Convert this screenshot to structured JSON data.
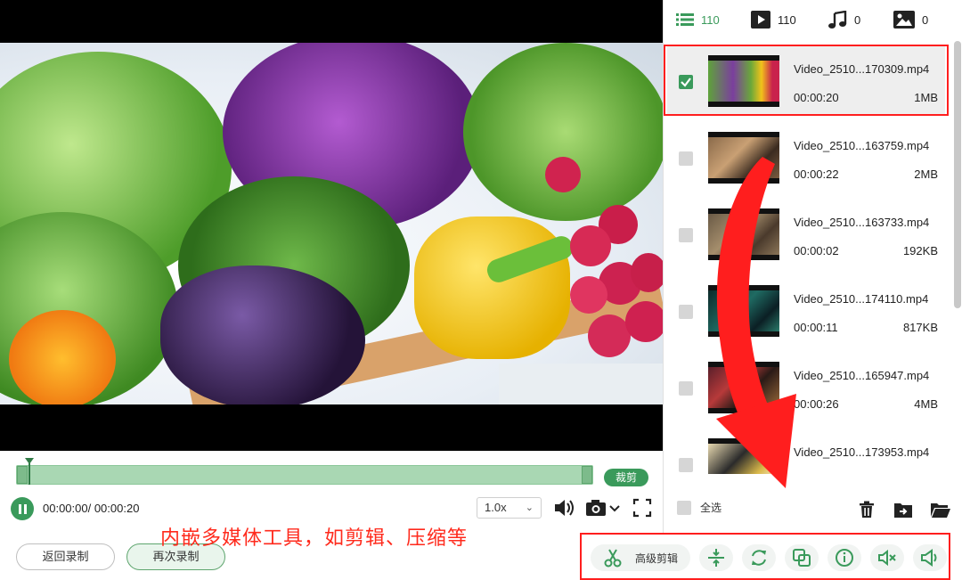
{
  "player": {
    "current_time": "00:00:00",
    "total_time": "00:00:20",
    "time_readout": "00:00:00/ 00:00:20",
    "speed": "1.0x",
    "crop_label": "裁剪"
  },
  "actions": {
    "back_to_record": "返回录制",
    "record_again": "再次录制"
  },
  "caption": "内嵌多媒体工具，如剪辑、压缩等",
  "tabs": [
    {
      "name": "all",
      "count": "110"
    },
    {
      "name": "video",
      "count": "110"
    },
    {
      "name": "audio",
      "count": "0"
    },
    {
      "name": "image",
      "count": "0"
    }
  ],
  "files": [
    {
      "name": "Video_2510...170309.mp4",
      "duration": "00:00:20",
      "size": "1MB",
      "checked": true
    },
    {
      "name": "Video_2510...163759.mp4",
      "duration": "00:00:22",
      "size": "2MB",
      "checked": false
    },
    {
      "name": "Video_2510...163733.mp4",
      "duration": "00:00:02",
      "size": "192KB",
      "checked": false
    },
    {
      "name": "Video_2510...174110.mp4",
      "duration": "00:00:11",
      "size": "817KB",
      "checked": false
    },
    {
      "name": "Video_2510...165947.mp4",
      "duration": "00:00:26",
      "size": "4MB",
      "checked": false
    },
    {
      "name": "Video_2510...173953.mp4",
      "duration": "",
      "size": "",
      "checked": false
    }
  ],
  "select_all_label": "全选",
  "tools": {
    "advanced_edit": "高级剪辑"
  },
  "colors": {
    "accent_green": "#3a9a5b",
    "highlight_red": "#ff1e1e"
  }
}
